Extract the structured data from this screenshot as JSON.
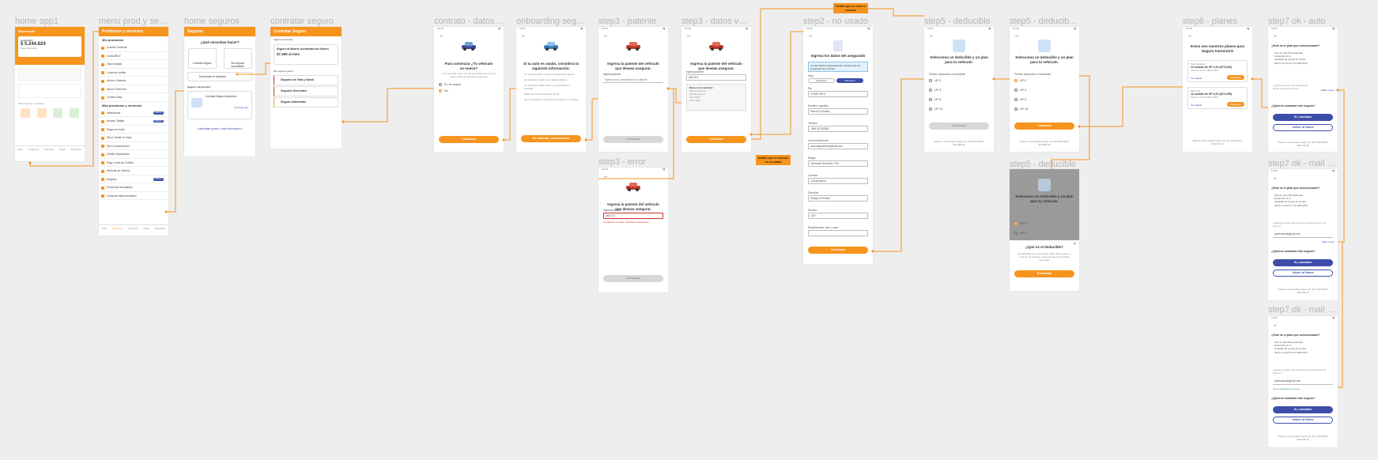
{
  "frames": {
    "home_app": "home app1",
    "menu": "menu prod y servi...",
    "home_seguros": "home seguros",
    "contratar": "contratar seguro",
    "contrato": "contrato - datos a...",
    "onboarding": "onboarding seguro...",
    "patente": "step3 - patente",
    "datos_vehi": "step3 - datos vehi...",
    "no_usado": "step2 - no usado",
    "deducible1": "step5 - deducible",
    "deducible2": "step5 - deducible ...",
    "planes": "step6 - planes",
    "ok_auto": "step7 ok - auto",
    "error": "step3 - error",
    "deducible3": "step5 - deducible",
    "ok_mail_send": "step7 ok - mail send",
    "ok_mail_ch": "step7 ok - mail ch..."
  },
  "status_time": "12:30",
  "home": {
    "header": "Bienvenido",
    "account": "CuentaRUT",
    "balance": "$ 5.244.824",
    "balance_sub": "Saldo disponible",
    "section": "Mis productos y servicios",
    "tabs": [
      "Inicio",
      "Productos",
      "Transferir",
      "Pagar",
      "Beneficios"
    ]
  },
  "menu": {
    "header": "Productos y servicios",
    "mis_productos": "Mis productos",
    "products": [
      "Cuenta Corriente",
      "CuentaRUT",
      "Visa Dorada",
      "Línea de crédito",
      "Ahorro Vivienda",
      "Ahorro Premium",
      "Cuenta Vista"
    ],
    "mas_productos": "Más productos y servicios",
    "more": [
      "Inversiones",
      "Avance Tarjeta",
      "Pagos en línea",
      "Giro Cuenta en línea",
      "Giro Cuenta Ahorro",
      "Crédito Hipotecario",
      "Pago Línea de Crédito",
      "Historial de Cartola",
      "Seguros",
      "Productos Vinculados",
      "Compras Internacionales"
    ],
    "badge": "NUEVO"
  },
  "home_seguros": {
    "header": "Seguros",
    "question": "¿Qué necesitas hacer?",
    "opt1": "Contratar seguro",
    "opt2": "Ver seguros contratados",
    "opt3": "Denunciar un siniestro",
    "section": "Seguros destacados",
    "card": "Contrata Seguro Automotriz",
    "card_link": "Contrata aquí",
    "help": "¿Necesitas ayuda o más información?"
  },
  "contratar": {
    "header": "Contratar Seguro",
    "destacado": "Seguro destacado",
    "promo": "Seguro de Muerte Accidental con Ahorro",
    "price": "$7.450 al mes",
    "section": "Mis seguros para ti",
    "items": [
      "Seguros de Vida y Salud",
      "Seguros Generales",
      "Seguro Automotriz"
    ]
  },
  "contrato": {
    "title": "Para comenzar ¿Tu vehículo es nuevo?",
    "body": "Si tu vehículo nuevo cuenta con factura de compra debes retirar el vehículo en agencia",
    "yes": "Sí, es nuevo",
    "no": "No",
    "cta": "Continuar"
  },
  "onboarding": {
    "title": "Si tu auto es usado, considera la siguiente información:",
    "bullets": [
      "Tu vehículo debe contar con inspección vigente.",
      "El vehículo no debe tener daños visibles.",
      "La inspección debe hacerse en la dirección indicada.",
      "Debe tener documentación al día.",
      "Si no apruebas la inspección el seguro no se activa."
    ],
    "cta": "De acuerdo, continuemos"
  },
  "patente": {
    "title": "Ingresa la patente del vehículo que deseas asegurar.",
    "label": "Ingresa patente",
    "placeholder": "Ingresa los 6 caracteres de tu patente",
    "cta": "Continuar"
  },
  "datos_vehi": {
    "title": "Ingresa la patente del vehículo que deseas asegurar.",
    "label": "Ingresa patente",
    "value": "ABCD12",
    "box_title": "Datos de tu vehículo:",
    "kv": [
      "Marca Hyundai",
      "Modelo Accent",
      "Año 2019",
      "Color Rojo"
    ],
    "cta": "Continuar"
  },
  "no_usado": {
    "title": "Ingresa los datos del asegurado",
    "info": "La información ingresada debe corresponder al propietario del vehículo.",
    "sexo_label": "Sexo",
    "sexo": [
      "Femenino",
      "Masculino"
    ],
    "fields": [
      {
        "label": "Rut",
        "value": "12.686.786-3"
      },
      {
        "label": "Nombre y apellido",
        "value": "Manuel González"
      },
      {
        "label": "Teléfono",
        "value": "+569 912345657"
      },
      {
        "label": "Correo electrónico",
        "value": "manuelgonzalez@gmail.com"
      },
      {
        "label": "Región",
        "value": "Libertador Bernardo O'Hi..."
      },
      {
        "label": "Comuna",
        "value": "La Esperanza"
      },
      {
        "label": "Dirección",
        "value": "Pasaje el Pehuén"
      },
      {
        "label": "Número",
        "value": "1337"
      },
      {
        "label": "Departamento, piso o casa",
        "value": ""
      }
    ],
    "cta": "Continuar"
  },
  "notes": {
    "top": "Detalle que no sean el vehículo",
    "mid": "Detalle que el vehículo no es usado"
  },
  "deducible": {
    "title": "Selecciona un deducible y un plan para tu vehículo.",
    "q": "Primero selecciona un deducible",
    "options": [
      "UF 0",
      "UF 3",
      "UF 5",
      "UF 10"
    ],
    "cta": "Continuar",
    "foot": "Valores referenciales según UF del 20/07/2024: $33.886,56"
  },
  "deducible_modal": {
    "title": "¿Qué es el deducible?",
    "body": "El deducible es el monto que usted debe pagar en caso de un siniestro, antes de que la compañía responda.",
    "cta": "Entendido"
  },
  "planes": {
    "title": "Estos son nuestros planes para Seguro Automotriz",
    "plan1": "Plan Estándar",
    "plan1_price": "12 cuotas de UF 2,23 ($70.026)",
    "plan1_total": "Total UF 26,64 ($904.566)",
    "plan2": "Plan Full",
    "plan2_price": "12 cuotas de UF 3,23 ($72.208)",
    "plan2_total": "Total UF 38,76 ($913.260)",
    "link": "Ver detalle",
    "cta": "Contratar",
    "foot": "Valores referenciales según UF del 27/10/2024: $38.444,33"
  },
  "ok": {
    "title": "¿Este es el plan que seleccionaste?",
    "kv": [
      "Tipo de plan  Plan Estándar",
      "Deducible  UF 0",
      "Cantidad de cuotas  12 cuotas",
      "Monto cuota  UF 2,23 ($70.026)"
    ],
    "mail_q": "¿Quieres enviar una copia de tus documentos a tu correo?",
    "mail_link": "Editar correo",
    "mail_value": "juanbustos@gmail.com",
    "mail_sent": "Se ha actualizado tu correo",
    "confirm": "¿Quieres contratar este seguro?",
    "cta": "Sí, contratar",
    "secondary": "Volver al Home",
    "foot": "Valores referenciales según UF del 27/10/2024: $38.444,33"
  },
  "error": {
    "title": "Ingresa la patente del vehículo que deseas asegurar.",
    "label": "Ingresa patente",
    "value": "ABCD12",
    "msg": "La patente no existe. Inténtalo nuevamente",
    "cta": "Continuar"
  },
  "colors": {
    "accent": "#f7941d",
    "blue": "#3e4ea8",
    "bg": "#eeeeee"
  }
}
